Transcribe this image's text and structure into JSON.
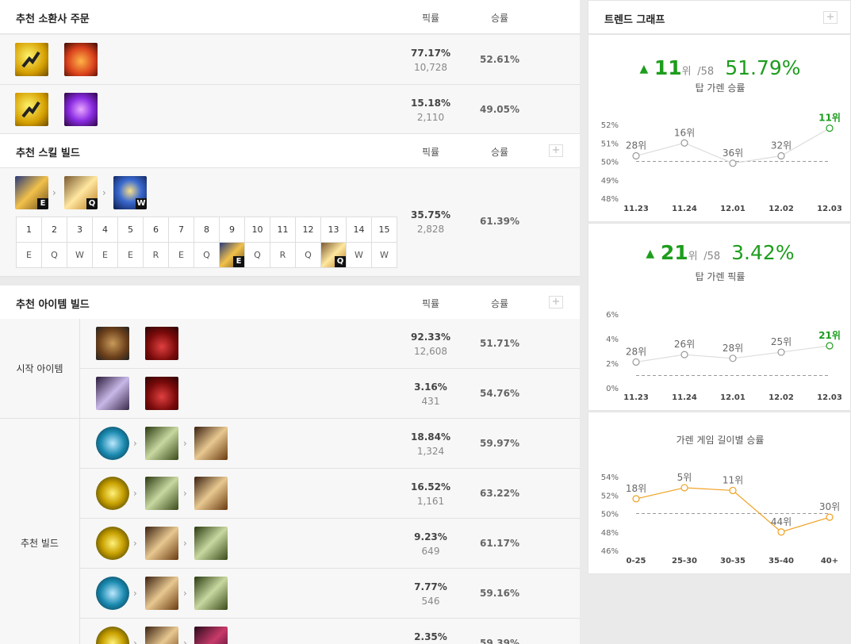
{
  "spells": {
    "title": "추천 소환사 주문",
    "col_pick": "픽률",
    "col_win": "승률",
    "rows": [
      {
        "pick": "77.17%",
        "count": "10,728",
        "win": "52.61%",
        "icons": [
          "ghost-spell-icon",
          "ignite-spell-icon"
        ]
      },
      {
        "pick": "15.18%",
        "count": "2,110",
        "win": "49.05%",
        "icons": [
          "ghost-spell-icon",
          "teleport-spell-icon"
        ]
      }
    ]
  },
  "skills": {
    "title": "추천 스킬 빌드",
    "col_pick": "픽률",
    "col_win": "승률",
    "order": [
      "E",
      "Q",
      "W"
    ],
    "levels": [
      "1",
      "2",
      "3",
      "4",
      "5",
      "6",
      "7",
      "8",
      "9",
      "10",
      "11",
      "12",
      "13",
      "14",
      "15"
    ],
    "keys": [
      "E",
      "Q",
      "W",
      "E",
      "E",
      "R",
      "E",
      "Q",
      "E",
      "Q",
      "R",
      "Q",
      "Q",
      "W",
      "W"
    ],
    "pick": "35.75%",
    "count": "2,828",
    "win": "61.39%"
  },
  "items": {
    "title": "추천 아이템 빌드",
    "col_pick": "픽률",
    "col_win": "승률",
    "start_label": "시작 아이템",
    "build_label": "추천 빌드",
    "start": [
      {
        "pick": "92.33%",
        "count": "12,608",
        "win": "51.71%"
      },
      {
        "pick": "3.16%",
        "count": "431",
        "win": "54.76%"
      }
    ],
    "builds": [
      {
        "pick": "18.84%",
        "count": "1,324",
        "win": "59.97%"
      },
      {
        "pick": "16.52%",
        "count": "1,161",
        "win": "63.22%"
      },
      {
        "pick": "9.23%",
        "count": "649",
        "win": "61.17%"
      },
      {
        "pick": "7.77%",
        "count": "546",
        "win": "59.16%"
      },
      {
        "pick": "2.35%",
        "count": "",
        "win": "59.39%"
      }
    ]
  },
  "trend": {
    "title": "트렌드 그래프",
    "win": {
      "rank": "11",
      "rank_unit": "위",
      "total": "/58",
      "value": "51.79%",
      "label": "탑 가렌 승률"
    },
    "pick": {
      "rank": "21",
      "rank_unit": "위",
      "total": "/58",
      "value": "3.42%",
      "label": "탑 가렌 픽률"
    },
    "gl_label": "가렌 게임 길이별 승률"
  },
  "colors": {
    "green": "#1d9d1d",
    "orange": "#f0a020",
    "gray": "#aaaaaa"
  },
  "chart_data": [
    {
      "type": "line",
      "x": [
        "11.23",
        "11.24",
        "12.01",
        "12.02",
        "12.03"
      ],
      "values": [
        50.3,
        51.0,
        49.9,
        50.3,
        51.8
      ],
      "labels": [
        "28위",
        "16위",
        "36위",
        "32위",
        "11위"
      ],
      "yticks": [
        "52%",
        "51%",
        "50%",
        "49%",
        "48%"
      ],
      "ylim": [
        48,
        52
      ]
    },
    {
      "type": "line",
      "x": [
        "11.23",
        "11.24",
        "12.01",
        "12.02",
        "12.03"
      ],
      "values": [
        2.1,
        2.7,
        2.4,
        2.9,
        3.42
      ],
      "labels": [
        "28위",
        "26위",
        "28위",
        "25위",
        "21위"
      ],
      "yticks": [
        "6%",
        "4%",
        "2%",
        "0%"
      ],
      "ylim": [
        0,
        6
      ]
    },
    {
      "type": "line",
      "title": "가렌 게임 길이별 승률",
      "x": [
        "0-25",
        "25-30",
        "30-35",
        "35-40",
        "40+"
      ],
      "values": [
        51.6,
        52.8,
        52.5,
        48.0,
        49.6
      ],
      "labels": [
        "18위",
        "5위",
        "11위",
        "44위",
        "30위"
      ],
      "yticks": [
        "54%",
        "52%",
        "50%",
        "48%",
        "46%"
      ],
      "ylim": [
        46,
        54
      ]
    }
  ]
}
